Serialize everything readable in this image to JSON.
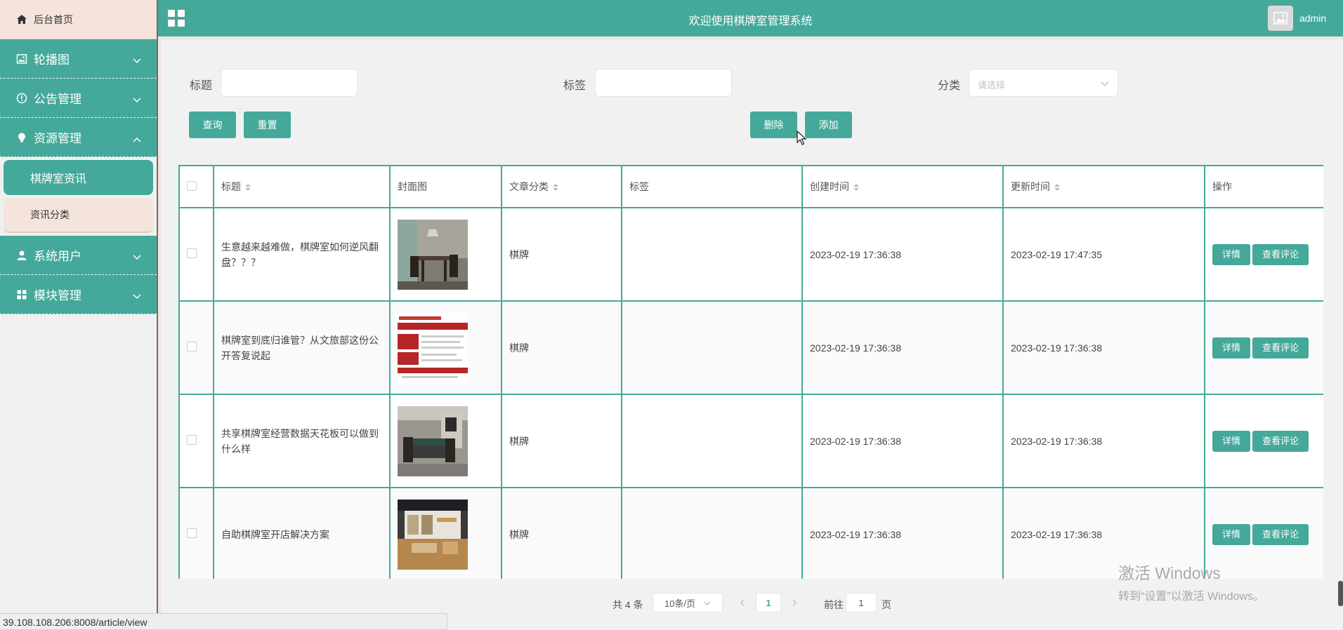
{
  "sidebar": {
    "home": "后台首页",
    "menus": [
      {
        "label": "轮播图",
        "icon": "image-icon"
      },
      {
        "label": "公告管理",
        "icon": "info-icon"
      },
      {
        "label": "资源管理",
        "icon": "bulb-icon"
      },
      {
        "label": "系统用户",
        "icon": "user-icon"
      },
      {
        "label": "模块管理",
        "icon": "grid-icon"
      }
    ],
    "sub_items": [
      "棋牌室资讯",
      "资讯分类"
    ]
  },
  "header": {
    "title": "欢迎使用棋牌室管理系统",
    "user": "admin"
  },
  "filters": {
    "title_label": "标题",
    "tag_label": "标签",
    "category_label": "分类",
    "category_placeholder": "请选择"
  },
  "buttons": {
    "query": "查询",
    "reset": "重置",
    "delete": "删除",
    "add": "添加"
  },
  "table": {
    "headers": [
      "标题",
      "封面图",
      "文章分类",
      "标签",
      "创建时间",
      "更新时间",
      "操作"
    ],
    "rows": [
      {
        "title": "生意越来越难做，棋牌室如何逆风翻盘？？？",
        "category": "棋牌",
        "tag": "",
        "created": "2023-02-19 17:36:38",
        "updated": "2023-02-19 17:47:35"
      },
      {
        "title": "棋牌室到底归谁管？从文旅部这份公开答复说起",
        "category": "棋牌",
        "tag": "",
        "created": "2023-02-19 17:36:38",
        "updated": "2023-02-19 17:36:38"
      },
      {
        "title": "共享棋牌室经营数据天花板可以做到什么样",
        "category": "棋牌",
        "tag": "",
        "created": "2023-02-19 17:36:38",
        "updated": "2023-02-19 17:36:38"
      },
      {
        "title": "自助棋牌室开店解决方案",
        "category": "棋牌",
        "tag": "",
        "created": "2023-02-19 17:36:38",
        "updated": "2023-02-19 17:36:38"
      }
    ],
    "detail_label": "详情",
    "comment_label": "查看评论"
  },
  "pagination": {
    "total": "共 4 条",
    "page_size": "10条/页",
    "current": "1",
    "goto_prefix": "前往",
    "goto_value": "1",
    "goto_suffix": "页"
  },
  "status_bar": "39.108.108.206:8008/article/view",
  "watermark": {
    "line1": "激活 Windows",
    "line2": "转到“设置”以激活 Windows。"
  },
  "colors": {
    "accent": "#44a99a",
    "peach": "#f4e4dc"
  }
}
